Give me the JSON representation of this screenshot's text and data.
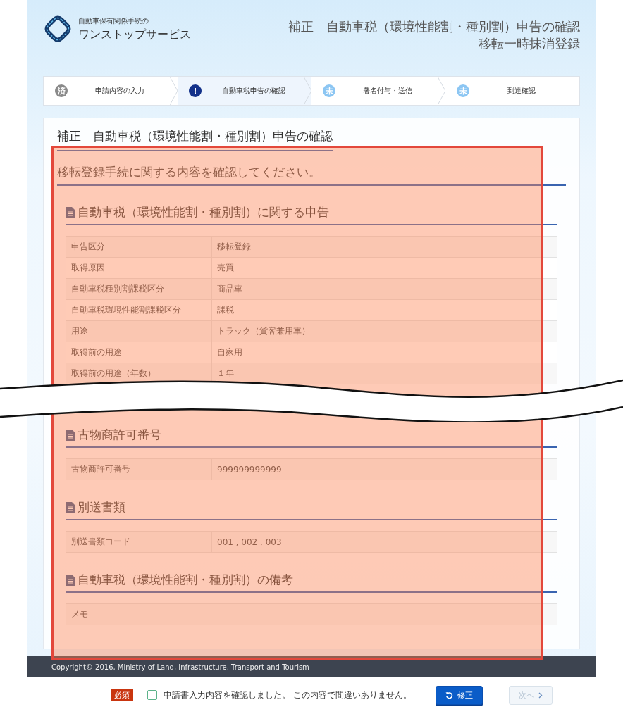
{
  "header": {
    "logo_caption": "自動車保有関係手続の",
    "logo_name": "ワンストップサービス",
    "title_lines": [
      "補正　自動車税（環境性能割・種別割）申告の確認",
      "移転一時抹消登録"
    ]
  },
  "steps": [
    {
      "badge": "済",
      "label": "申請内容の入力",
      "kind": "done",
      "selected": false
    },
    {
      "badge": "!",
      "label": "自動車税申告の確認",
      "kind": "current",
      "selected": true
    },
    {
      "badge": "未",
      "label": "署名付与・送信",
      "kind": "pending",
      "selected": false
    },
    {
      "badge": "未",
      "label": "到達確認",
      "kind": "pending",
      "selected": false
    }
  ],
  "page_title": "補正　自動車税（環境性能割・種別割）申告の確認",
  "instruction": "移転登録手続に関する内容を確認してください。",
  "sections": [
    {
      "title": "自動車税（環境性能割・種別割）に関する申告",
      "rows": [
        {
          "label": "申告区分",
          "value": "移転登録"
        },
        {
          "label": "取得原因",
          "value": "売買"
        },
        {
          "label": "自動車税種別割課税区分",
          "value": "商品車"
        },
        {
          "label": "自動車税環境性能割課税区分",
          "value": "課税"
        },
        {
          "label": "用途",
          "value": "トラック（貨客兼用車）"
        },
        {
          "label": "取得前の用途",
          "value": "自家用"
        },
        {
          "label": "取得前の用途（年数）",
          "value": "１年"
        }
      ]
    },
    {
      "title": "古物商許可番号",
      "rows": [
        {
          "label": "古物商許可番号",
          "value": "999999999999"
        }
      ]
    },
    {
      "title": "別送書類",
      "rows": [
        {
          "label": "別送書類コード",
          "value": "001 , 002 , 003"
        }
      ]
    },
    {
      "title": "自動車税（環境性能割・種別割）の備考",
      "rows": [
        {
          "label": "メモ"
        }
      ]
    }
  ],
  "footer": {
    "copyright": "Copyright© 2016, Ministry of Land, Infrastructure, Transport and Tourism"
  },
  "confirm_bar": {
    "required_badge": "必須",
    "confirm_label": "申請書入力内容を確認しました。 この内容で間違いありません。",
    "checked": false,
    "buttons": [
      {
        "label": "修正",
        "kind": "primary",
        "disabled": false
      },
      {
        "label": "次へ",
        "kind": "next",
        "disabled": true
      }
    ]
  }
}
